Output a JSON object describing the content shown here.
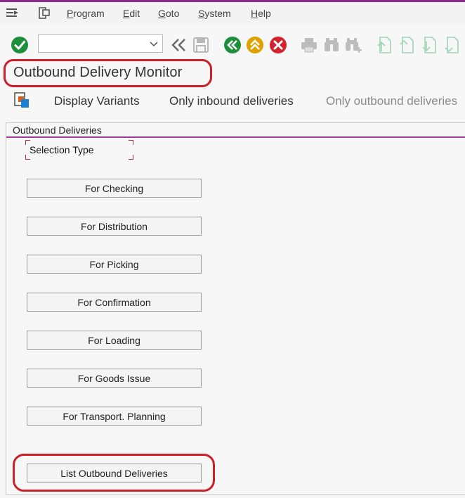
{
  "menu": {
    "items": [
      "Program",
      "Edit",
      "Goto",
      "System",
      "Help"
    ],
    "icons": [
      "exit-menu-icon",
      "customize-layout-icon"
    ]
  },
  "toolbar": {
    "command_field_value": "",
    "icons": [
      "enter-icon",
      "command-field-collapse-icon",
      "save-icon",
      "back-icon",
      "exit-icon",
      "cancel-icon",
      "print-icon",
      "find-icon",
      "find-next-icon",
      "first-page-icon",
      "previous-page-icon",
      "next-page-icon",
      "last-page-icon"
    ],
    "colors": {
      "green": "#1e8f3a",
      "amber": "#e0a100",
      "red": "#d3232f"
    }
  },
  "title": {
    "text": "Outbound Delivery Monitor"
  },
  "app_toolbar": {
    "display_variants": "Display Variants",
    "only_inbound": "Only inbound deliveries",
    "only_outbound": "Only outbound deliveries"
  },
  "panel": {
    "title": "Outbound Deliveries",
    "selection_type_label": "Selection Type",
    "buttons": [
      "For Checking",
      "For Distribution",
      "For Picking",
      "For Confirmation",
      "For Loading",
      "For Goods Issue",
      "For Transport. Planning",
      "List Outbound Deliveries"
    ]
  },
  "highlight_color": "#cc1f2a",
  "accent_color": "#8a2a8f"
}
